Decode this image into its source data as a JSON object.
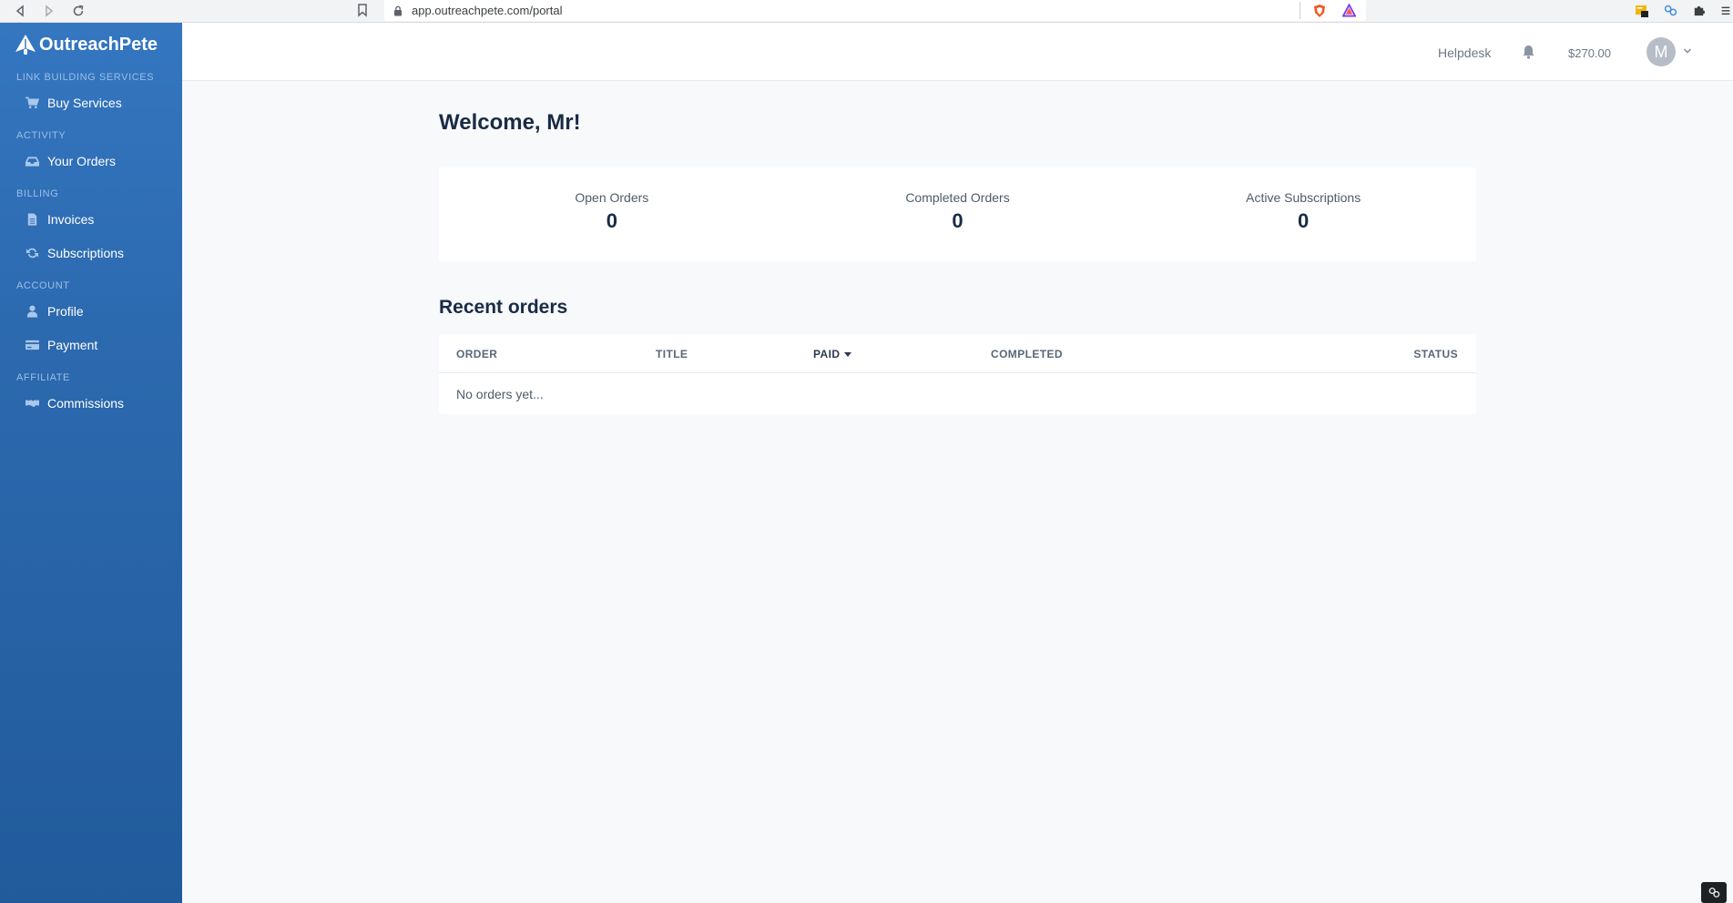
{
  "browser": {
    "url": "app.outreachpete.com/portal"
  },
  "brand": {
    "name": "OutreachPete"
  },
  "sidebar": {
    "sections": [
      {
        "title": "LINK BUILDING SERVICES",
        "items": [
          {
            "label": "Buy Services",
            "icon": "cart-icon"
          }
        ]
      },
      {
        "title": "ACTIVITY",
        "items": [
          {
            "label": "Your Orders",
            "icon": "inbox-icon"
          }
        ]
      },
      {
        "title": "BILLING",
        "items": [
          {
            "label": "Invoices",
            "icon": "file-icon"
          },
          {
            "label": "Subscriptions",
            "icon": "refresh-icon"
          }
        ]
      },
      {
        "title": "ACCOUNT",
        "items": [
          {
            "label": "Profile",
            "icon": "user-icon"
          },
          {
            "label": "Payment",
            "icon": "credit-card-icon"
          }
        ]
      },
      {
        "title": "AFFILIATE",
        "items": [
          {
            "label": "Commissions",
            "icon": "handshake-icon"
          }
        ]
      }
    ]
  },
  "header": {
    "helpdesk": "Helpdesk",
    "balance": "$270.00",
    "avatar_initial": "M"
  },
  "main": {
    "welcome": "Welcome, Mr!",
    "stats": [
      {
        "label": "Open Orders",
        "value": "0"
      },
      {
        "label": "Completed Orders",
        "value": "0"
      },
      {
        "label": "Active Subscriptions",
        "value": "0"
      }
    ],
    "recent_title": "Recent orders",
    "table": {
      "columns": [
        "ORDER",
        "TITLE",
        "PAID",
        "COMPLETED",
        "STATUS"
      ],
      "empty_text": "No orders yet..."
    }
  },
  "colors": {
    "sidebar": "#2b68ad",
    "accent": "#1a2b45"
  }
}
